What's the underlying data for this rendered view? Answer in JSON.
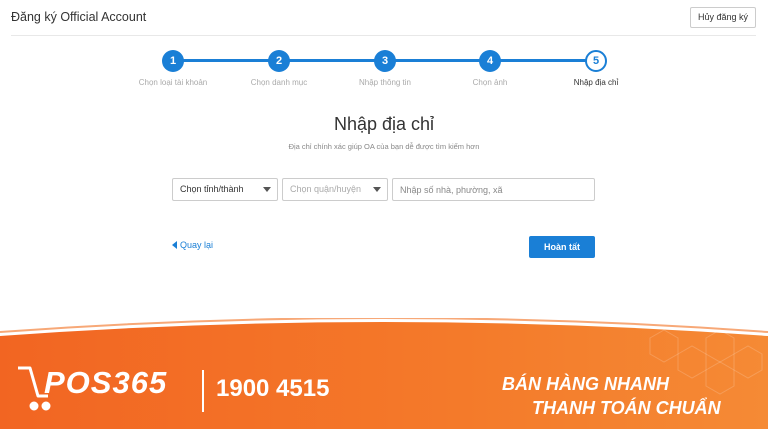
{
  "header": {
    "title": "Đăng ký Official Account",
    "cancel_label": "Hủy đăng ký"
  },
  "steps": [
    {
      "number": "1",
      "label": "Chọn loại tài khoản",
      "status": "done"
    },
    {
      "number": "2",
      "label": "Chọn danh mục",
      "status": "done"
    },
    {
      "number": "3",
      "label": "Nhập thông tin",
      "status": "done"
    },
    {
      "number": "4",
      "label": "Chọn ảnh",
      "status": "done"
    },
    {
      "number": "5",
      "label": "Nhập địa chỉ",
      "status": "current"
    }
  ],
  "main": {
    "title": "Nhập địa chỉ",
    "subtitle": "Địa chỉ chính xác giúp OA của bạn dễ được tìm kiếm hơn",
    "province_select": "Chọn tỉnh/thành",
    "district_select": "Chọn quận/huyện",
    "address_placeholder": "Nhập số nhà, phường, xã",
    "back_label": "Quay lại",
    "done_label": "Hoàn tất"
  },
  "banner": {
    "logo": "POS365",
    "phone": "1900 4515",
    "slogan_line1": "BÁN HÀNG NHANH",
    "slogan_line2": "THANH TOÁN CHUẨN"
  },
  "colors": {
    "accent": "#1a7fd6",
    "banner": "#f26522"
  }
}
